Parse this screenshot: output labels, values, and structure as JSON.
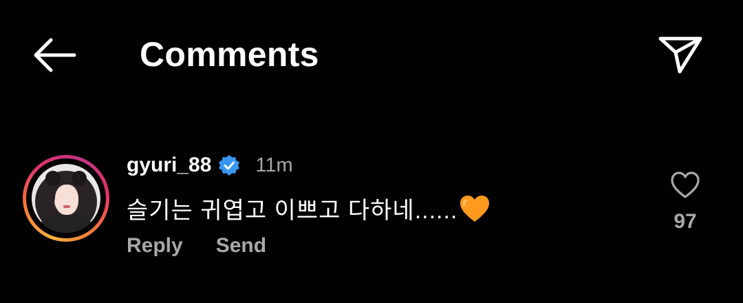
{
  "header": {
    "title": "Comments",
    "back_icon": "arrow-left-icon",
    "share_icon": "paper-plane-icon"
  },
  "comment": {
    "username": "gyuri_88",
    "verified": true,
    "time": "11m",
    "text": "슬기는 귀엽고 이쁘고 다하네......",
    "emoji": "orange-heart-emoji",
    "reply_label": "Reply",
    "send_label": "Send",
    "likes": "97",
    "like_icon": "heart-outline-icon"
  },
  "colors": {
    "background": "#000000",
    "primary_text": "#ffffff",
    "secondary_text": "#a8a8a8",
    "verified_badge": "#3897f0",
    "emoji_heart": "#ff9a1f"
  }
}
